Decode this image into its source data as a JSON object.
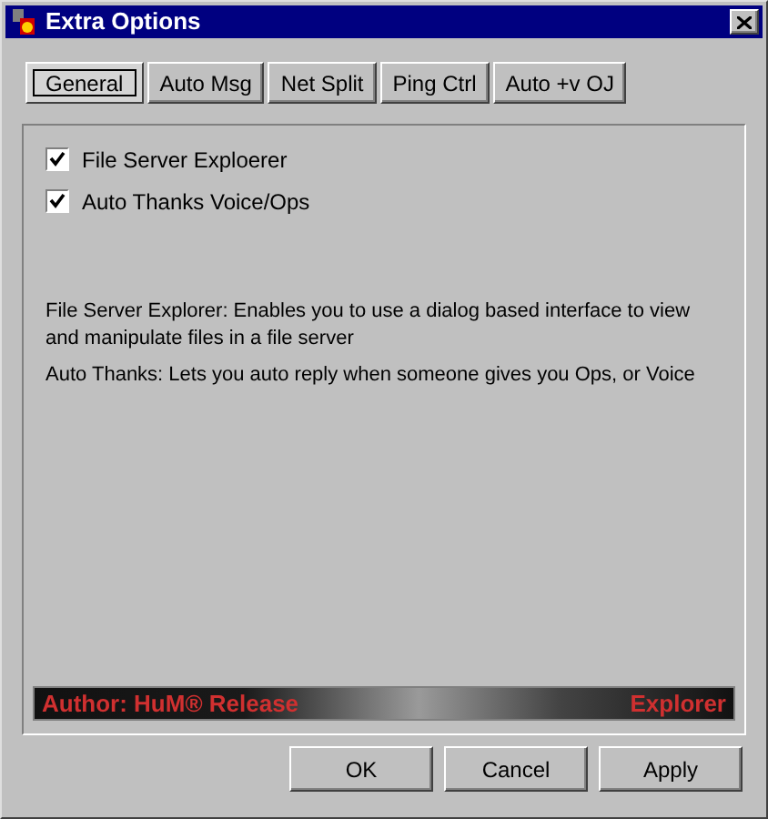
{
  "window": {
    "title": "Extra Options"
  },
  "tabs": [
    {
      "label": "General",
      "selected": true
    },
    {
      "label": "Auto Msg",
      "selected": false
    },
    {
      "label": "Net Split",
      "selected": false
    },
    {
      "label": "Ping Ctrl",
      "selected": false
    },
    {
      "label": "Auto +v OJ",
      "selected": false
    }
  ],
  "options": [
    {
      "label": "File Server Exploerer",
      "checked": true
    },
    {
      "label": "Auto Thanks Voice/Ops",
      "checked": true
    }
  ],
  "descriptions": [
    "File Server Explorer: Enables you to use a dialog based interface to view and manipulate files in a file server",
    "Auto Thanks: Lets you auto reply when someone gives you Ops, or Voice"
  ],
  "banner": {
    "left": "Author: HuM® Release",
    "right": "Explorer"
  },
  "buttons": [
    "OK",
    "Cancel",
    "Apply"
  ]
}
